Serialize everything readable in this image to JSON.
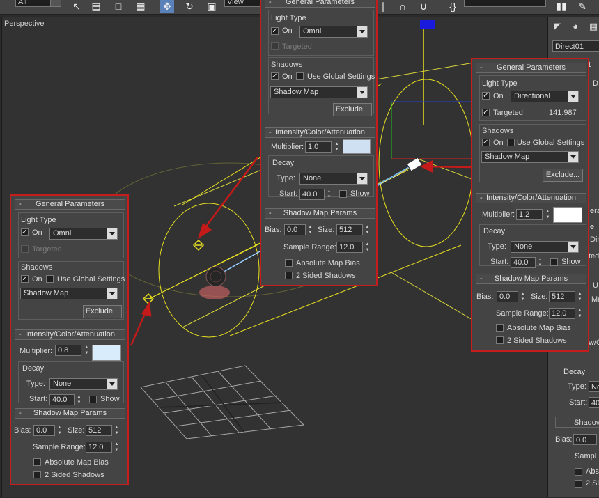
{
  "toolbar": {
    "selection_filter": "All",
    "reference_coord": "View",
    "named_selection": ""
  },
  "viewport": {
    "label": "Perspective"
  },
  "command_panel": {
    "object_name": "Direct01",
    "fragments": [
      "t",
      "D",
      "era",
      "e",
      "Dir",
      "ted",
      "U",
      "Ma",
      "w/O",
      "Decay",
      "Type:",
      "No",
      "Start:",
      "40.",
      "Shadov",
      "Bias:",
      "0.0",
      "Sampl",
      "Abs",
      "2 Si"
    ]
  },
  "colors": {
    "highlight_border": "#c61c1c",
    "gizmo_yellow": "#e8e020",
    "grid": "#a8a8a8"
  },
  "panel_omni_top": {
    "general_title": "General Parameters",
    "light_type_label": "Light Type",
    "on_label": "On",
    "light_type_value": "Omni",
    "targeted_label": "Targeted",
    "shadows_label": "Shadows",
    "shadows_on_label": "On",
    "use_global_label": "Use Global Settings",
    "shadow_type": "Shadow Map",
    "exclude_label": "Exclude...",
    "intensity_title": "Intensity/Color/Attenuation",
    "multiplier_label": "Multiplier:",
    "multiplier_value": "1.0",
    "decay_label": "Decay",
    "type_label": "Type:",
    "decay_type": "None",
    "start_label": "Start:",
    "start_value": "40.0",
    "show_label": "Show",
    "shadowmap_title": "Shadow Map Params",
    "bias_label": "Bias:",
    "bias_value": "0.0",
    "size_label": "Size:",
    "size_value": "512",
    "sample_range_label": "Sample Range:",
    "sample_range_value": "12.0",
    "absolute_bias_label": "Absolute Map Bias",
    "two_sided_label": "2 Sided Shadows"
  },
  "panel_directional": {
    "general_title": "General Parameters",
    "light_type_label": "Light Type",
    "on_label": "On",
    "light_type_value": "Directional",
    "targeted_label": "Targeted",
    "targeted_value": "141.987",
    "shadows_label": "Shadows",
    "shadows_on_label": "On",
    "use_global_label": "Use Global Settings",
    "shadow_type": "Shadow Map",
    "exclude_label": "Exclude...",
    "intensity_title": "Intensity/Color/Attenuation",
    "multiplier_label": "Multiplier:",
    "multiplier_value": "1.2",
    "decay_label": "Decay",
    "type_label": "Type:",
    "decay_type": "None",
    "start_label": "Start:",
    "start_value": "40.0",
    "show_label": "Show",
    "shadowmap_title": "Shadow Map Params",
    "bias_label": "Bias:",
    "bias_value": "0.0",
    "size_label": "Size:",
    "size_value": "512",
    "sample_range_label": "Sample Range:",
    "sample_range_value": "12.0",
    "absolute_bias_label": "Absolute Map Bias",
    "two_sided_label": "2 Sided Shadows"
  },
  "panel_omni_left": {
    "general_title": "General Parameters",
    "light_type_label": "Light Type",
    "on_label": "On",
    "light_type_value": "Omni",
    "targeted_label": "Targeted",
    "shadows_label": "Shadows",
    "shadows_on_label": "On",
    "use_global_label": "Use Global Settings",
    "shadow_type": "Shadow Map",
    "exclude_label": "Exclude...",
    "intensity_title": "Intensity/Color/Attenuation",
    "multiplier_label": "Multiplier:",
    "multiplier_value": "0.8",
    "decay_label": "Decay",
    "type_label": "Type:",
    "decay_type": "None",
    "start_label": "Start:",
    "start_value": "40.0",
    "show_label": "Show",
    "shadowmap_title": "Shadow Map Params",
    "bias_label": "Bias:",
    "bias_value": "0.0",
    "size_label": "Size:",
    "size_value": "512",
    "sample_range_label": "Sample Range:",
    "sample_range_value": "12.0",
    "absolute_bias_label": "Absolute Map Bias",
    "two_sided_label": "2 Sided Shadows"
  }
}
